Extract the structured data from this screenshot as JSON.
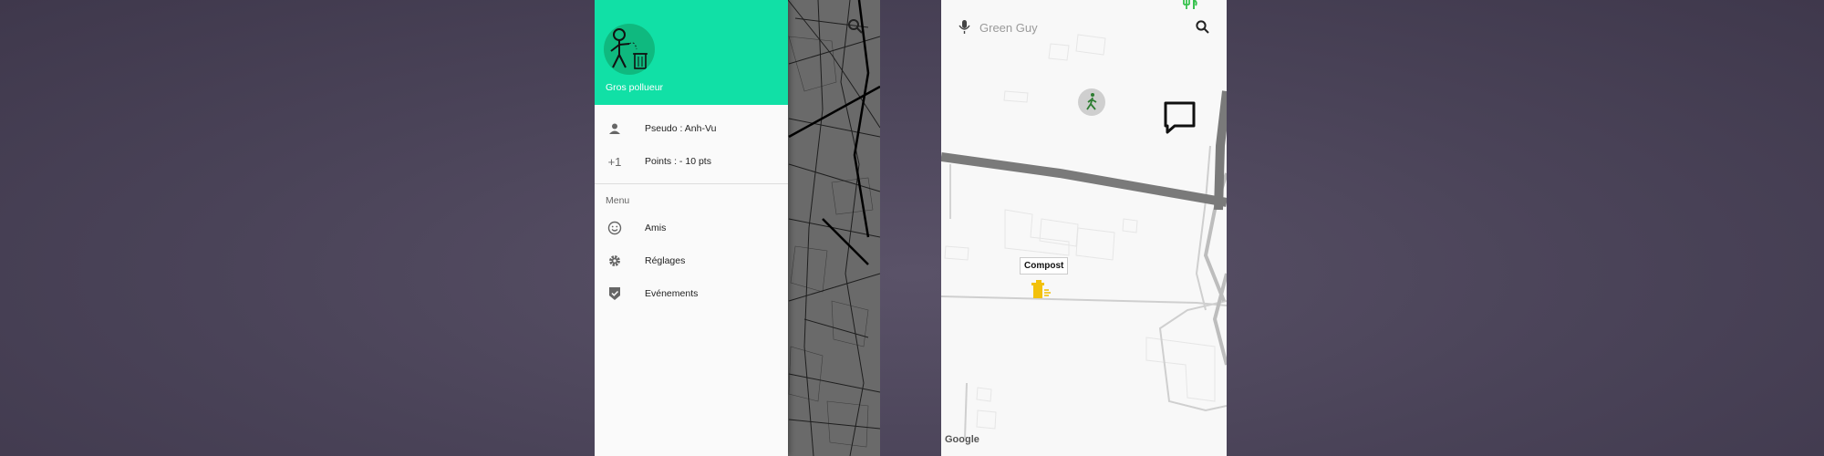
{
  "left_screen": {
    "header": {
      "profile_name": "Gros pollueur"
    },
    "info_items": [
      {
        "icon": "person-icon",
        "label": "Pseudo : Anh-Vu"
      },
      {
        "icon": "plus-one-icon",
        "label": "Points : - 10 pts"
      }
    ],
    "menu": {
      "title": "Menu",
      "items": [
        {
          "icon": "smiley-icon",
          "label": "Amis"
        },
        {
          "icon": "gear-icon",
          "label": "Réglages"
        },
        {
          "icon": "shield-check-icon",
          "label": "Evénements"
        }
      ]
    },
    "map_labels": []
  },
  "right_screen": {
    "search": {
      "placeholder": "Green Guy"
    },
    "marker": {
      "label": "Compost"
    },
    "brand": "Google"
  },
  "colors": {
    "accent": "#11e0a6",
    "avatar_bg": "#0fb97f",
    "compost_yellow": "#f2c10b",
    "restaurant_green": "#39c24f"
  }
}
